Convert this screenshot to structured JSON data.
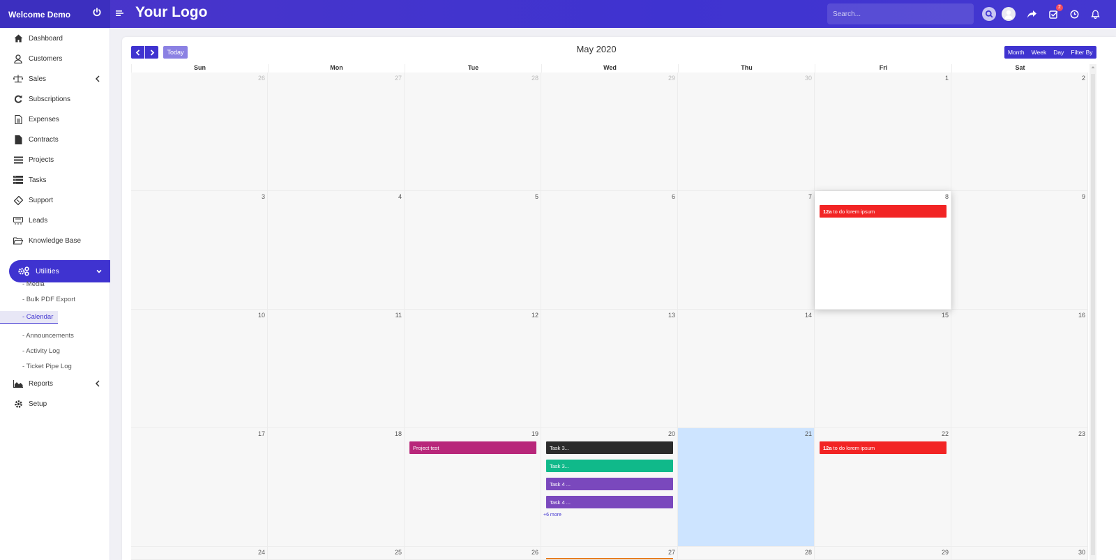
{
  "header": {
    "brand": "Welcome Demo",
    "logo": "Your Logo",
    "search_placeholder": "Search...",
    "task_badge": "2"
  },
  "sidebar": {
    "items": [
      {
        "label": "Dashboard",
        "icon": "home-icon"
      },
      {
        "label": "Customers",
        "icon": "user-icon"
      },
      {
        "label": "Sales",
        "icon": "scale-icon"
      },
      {
        "label": "Subscriptions",
        "icon": "refresh-icon"
      },
      {
        "label": "Expenses",
        "icon": "file-text-icon"
      },
      {
        "label": "Contracts",
        "icon": "file-icon"
      },
      {
        "label": "Projects",
        "icon": "list-icon"
      },
      {
        "label": "Tasks",
        "icon": "tasks-icon"
      },
      {
        "label": "Support",
        "icon": "ticket-icon"
      },
      {
        "label": "Leads",
        "icon": "leads-icon"
      },
      {
        "label": "Knowledge Base",
        "icon": "folder-open-icon"
      }
    ],
    "utilities": "Utilities",
    "sub_items": [
      "- Media",
      "- Bulk PDF Export",
      "- Calendar",
      "- Announcements",
      "- Activity Log",
      "- Ticket Pipe Log"
    ],
    "reports": "Reports",
    "setup": "Setup"
  },
  "calendar": {
    "title": "May 2020",
    "today_label": "Today",
    "views": [
      "Month",
      "Week",
      "Day",
      "Filter By"
    ],
    "days_of_week": [
      "Sun",
      "Mon",
      "Tue",
      "Wed",
      "Thu",
      "Fri",
      "Sat"
    ],
    "weeks": [
      [
        "26",
        "27",
        "28",
        "29",
        "30",
        "1",
        "2"
      ],
      [
        "3",
        "4",
        "5",
        "6",
        "7",
        "8",
        "9"
      ],
      [
        "10",
        "11",
        "12",
        "13",
        "14",
        "15",
        "16"
      ],
      [
        "17",
        "18",
        "19",
        "20",
        "21",
        "22",
        "23"
      ],
      [
        "24",
        "25",
        "26",
        "27",
        "28",
        "29",
        "30"
      ]
    ],
    "events": {
      "fri8_time": "12a",
      "fri8_title": "to do lorem ipsum",
      "tue19": "Project test",
      "wed20_1": "Task 3...",
      "wed20_2": "Task 3...",
      "wed20_3": "Task 4 ...",
      "wed20_4": "Task 4 ...",
      "wed20_more": "+6 more",
      "fri22_time": "12a",
      "fri22_title": "to do lorem ipsum"
    },
    "colors": {
      "accent": "#3f33d0",
      "red_event": "#f22424",
      "magenta_event": "#b8277a",
      "dark_event": "#2b2b2b",
      "green_event": "#10b98a",
      "purple_event": "#7a48bd",
      "today_bg": "#cde4ff"
    }
  }
}
